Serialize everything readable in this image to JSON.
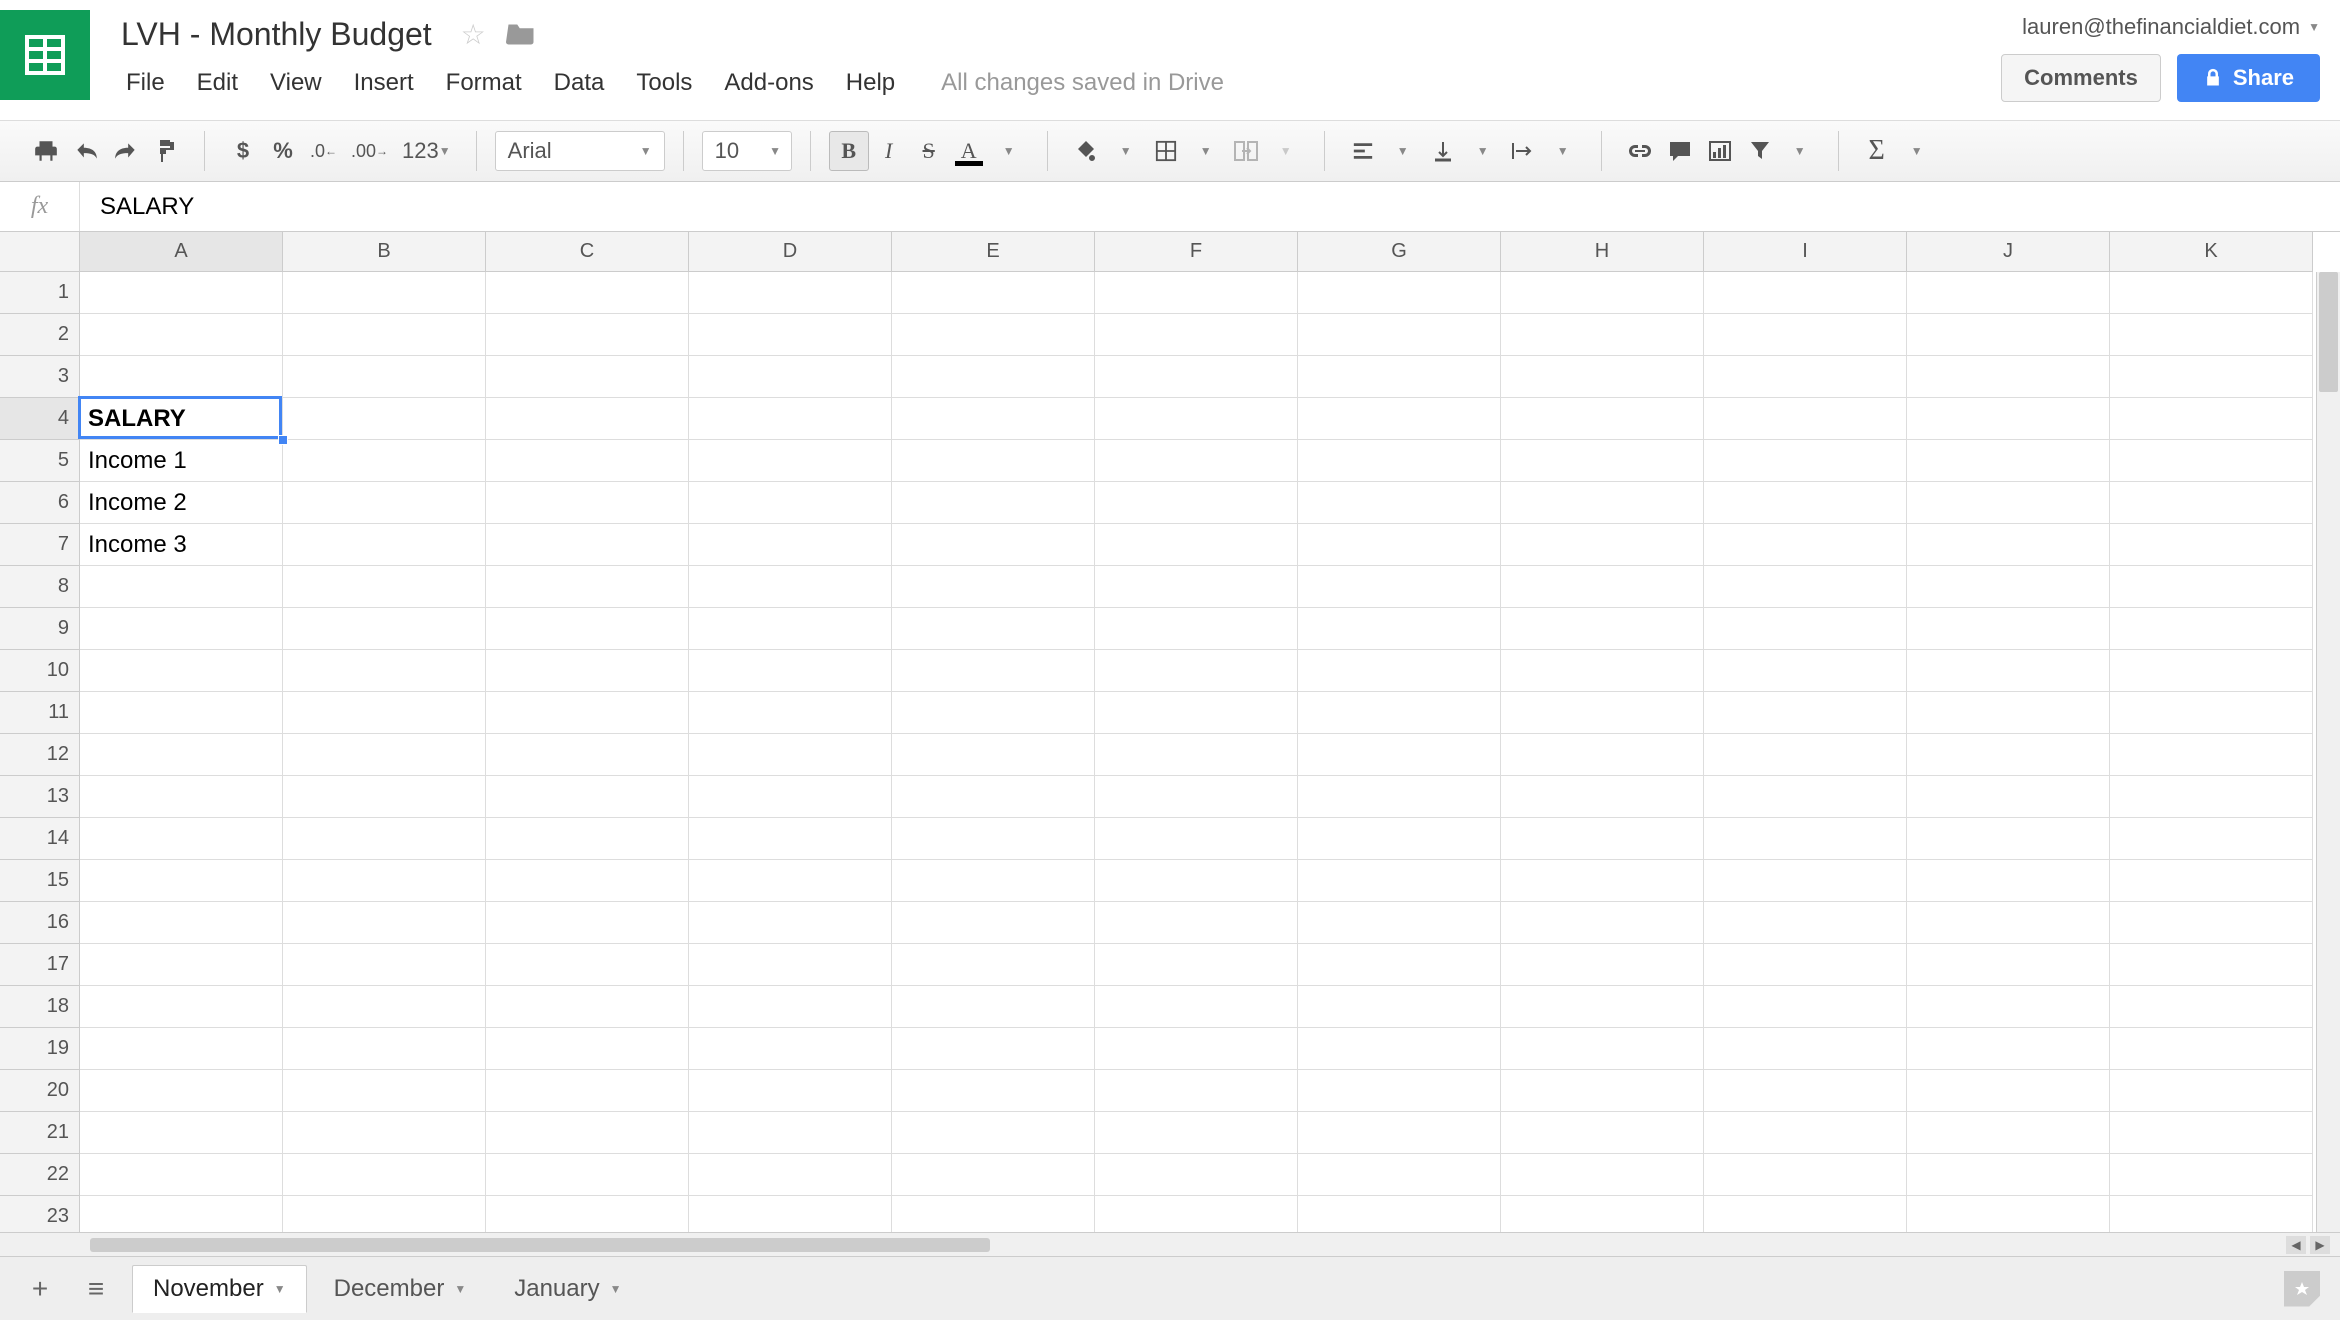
{
  "doc": {
    "title": "LVH - Monthly Budget",
    "save_status": "All changes saved in Drive",
    "user_email": "lauren@thefinancialdiet.com"
  },
  "menus": [
    "File",
    "Edit",
    "View",
    "Insert",
    "Format",
    "Data",
    "Tools",
    "Add-ons",
    "Help"
  ],
  "header_buttons": {
    "comments": "Comments",
    "share": "Share"
  },
  "toolbar": {
    "font": "Arial",
    "font_size": "10",
    "number_format_label": "123"
  },
  "formula_bar": {
    "fx": "fx",
    "value": "SALARY"
  },
  "columns": [
    "A",
    "B",
    "C",
    "D",
    "E",
    "F",
    "G",
    "H",
    "I",
    "J",
    "K"
  ],
  "rows": 23,
  "selected_cell": {
    "row": 4,
    "col": "A"
  },
  "cells": {
    "A4": {
      "value": "SALARY",
      "bold": true
    },
    "A5": {
      "value": "Income 1"
    },
    "A6": {
      "value": "Income 2"
    },
    "A7": {
      "value": "Income 3"
    }
  },
  "sheets": {
    "tabs": [
      "November",
      "December",
      "January"
    ],
    "active": "November"
  }
}
